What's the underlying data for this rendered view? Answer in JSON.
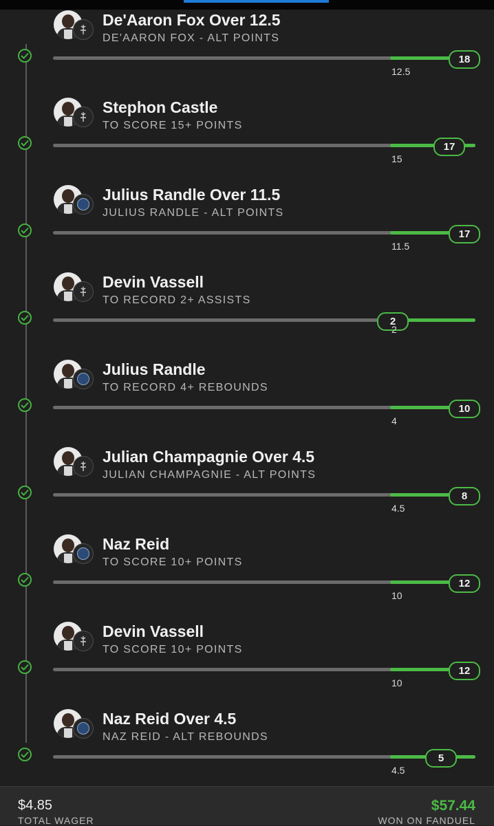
{
  "bet_slip": {
    "legs": [
      {
        "title": "De'Aaron Fox Over 12.5",
        "subtitle": "DE'AARON FOX - ALT POINTS",
        "threshold": "12.5",
        "result": "18",
        "team": "spurs"
      },
      {
        "title": "Stephon Castle",
        "subtitle": "TO SCORE 15+ POINTS",
        "threshold": "15",
        "result": "17",
        "team": "spurs"
      },
      {
        "title": "Julius Randle Over 11.5",
        "subtitle": "JULIUS RANDLE - ALT POINTS",
        "threshold": "11.5",
        "result": "17",
        "team": "timberwolves"
      },
      {
        "title": "Devin Vassell",
        "subtitle": "TO RECORD 2+ ASSISTS",
        "threshold": "2",
        "result": "2",
        "team": "spurs"
      },
      {
        "title": "Julius Randle",
        "subtitle": "TO RECORD 4+ REBOUNDS",
        "threshold": "4",
        "result": "10",
        "team": "timberwolves"
      },
      {
        "title": "Julian Champagnie Over 4.5",
        "subtitle": "JULIAN CHAMPAGNIE - ALT POINTS",
        "threshold": "4.5",
        "result": "8",
        "team": "spurs"
      },
      {
        "title": "Naz Reid",
        "subtitle": "TO SCORE 10+ POINTS",
        "threshold": "10",
        "result": "12",
        "team": "timberwolves"
      },
      {
        "title": "Devin Vassell",
        "subtitle": "TO SCORE 10+ POINTS",
        "threshold": "10",
        "result": "12",
        "team": "spurs"
      },
      {
        "title": "Naz Reid Over 4.5",
        "subtitle": "NAZ REID - ALT REBOUNDS",
        "threshold": "4.5",
        "result": "5",
        "team": "timberwolves"
      }
    ]
  },
  "footer": {
    "wager_amount": "$4.85",
    "wager_label": "TOTAL WAGER",
    "won_amount": "$57.44",
    "won_label": "WON ON FANDUEL"
  },
  "colors": {
    "success": "#4cba46",
    "accent": "#1e7bd6",
    "background": "#1f1f1f"
  }
}
